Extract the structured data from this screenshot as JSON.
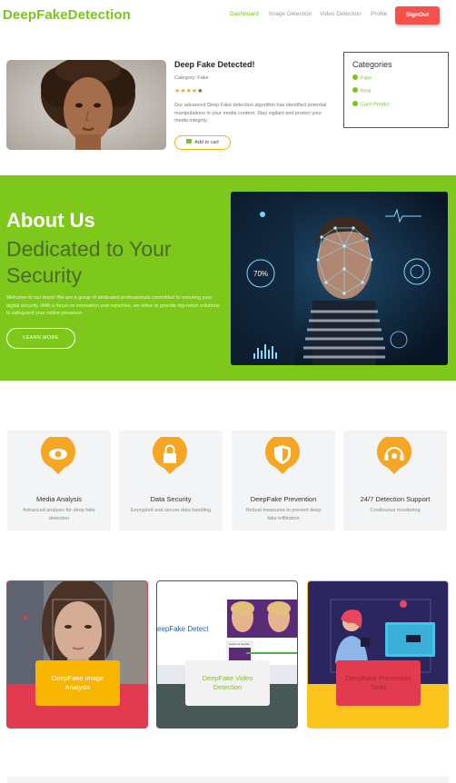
{
  "nav": {
    "brand": "DeepFakeDetection",
    "links": [
      "Dashboard",
      "Image Detection",
      "Video Detection",
      "Profile"
    ],
    "active": "Dashboard",
    "signout": "SignOut"
  },
  "product": {
    "title": "Deep Fake Detected!",
    "category": "Category: Fake",
    "rating": 4,
    "rating_max": 5,
    "description": "Our advanced Deep Fake detection algorithm has identified potential manipulations in your media content. Stay vigilant and protect your media integrity.",
    "cart_label": "Add to cart"
  },
  "categories": {
    "title": "Categories",
    "items": [
      "Fake",
      "Real",
      "Can't Predict"
    ]
  },
  "about": {
    "heading": "About Us",
    "subheading": "Dedicated to Your Security",
    "text": "Welcome to our team! We are a group of dedicated professionals committed to ensuring your digital security. With a focus on innovation and expertise, we strive to provide top-notch solutions to safeguard your online presence.",
    "button": "LEARN MORE",
    "image_badge": "70%"
  },
  "features": [
    {
      "title": "Media Analysis",
      "desc": "Advanced analysis for deep fake detection",
      "icon": "eye-icon"
    },
    {
      "title": "Data Security",
      "desc": "Encrypted and secure data handling",
      "icon": "lock-icon"
    },
    {
      "title": "DeepFake Prevention",
      "desc": "Robust measures to prevent deep fake infiltration",
      "icon": "shield-icon"
    },
    {
      "title": "24/7 Detection Support",
      "desc": "Continuous monitoring",
      "icon": "headset-icon"
    }
  ],
  "tools": [
    {
      "label": "DeepFake Image Analysis",
      "bg": "#e23a4e",
      "label_bg": "#f7b500",
      "label_color": "#ffffff"
    },
    {
      "label": "DeepFake Video Detection",
      "bg": "#475856",
      "label_bg": "#f2f2f2",
      "label_color": "#7cc41b"
    },
    {
      "label": "DeepFake Prevention Tools",
      "bg": "#fcc41d",
      "label_bg": "#e23a4e",
      "label_color": "#a6283a"
    }
  ],
  "tool_video_screen": {
    "heading": "eepFake Detect",
    "button": "Analyze for Deepfak"
  },
  "colors": {
    "accent": "#7cc41b",
    "about_bg": "#7ec81b",
    "signout": "#f5514b",
    "feature_icon": "#f5a623"
  }
}
